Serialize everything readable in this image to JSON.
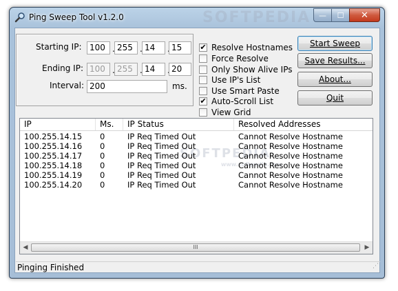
{
  "window": {
    "title": "Ping Sweep Tool v1.2.0",
    "controls": {
      "minimize": "—",
      "maximize": "☐",
      "close": "✕"
    }
  },
  "ip_range": {
    "starting_label": "Starting IP:",
    "starting_ip": [
      "100",
      "255",
      "14",
      "15"
    ],
    "ending_label": "Ending IP:",
    "ending_ip": [
      "100",
      "255",
      "14",
      "20"
    ],
    "interval_label": "Interval:",
    "interval_value": "200",
    "interval_unit": "ms.",
    "separator": "."
  },
  "options": [
    {
      "label": "Resolve Hostnames",
      "checked": true
    },
    {
      "label": "Force Resolve",
      "checked": false
    },
    {
      "label": "Only Show Alive IPs",
      "checked": false
    },
    {
      "label": "Use IP's List",
      "checked": false
    },
    {
      "label": "Use Smart Paste",
      "checked": false
    },
    {
      "label": "Auto-Scroll List",
      "checked": true
    },
    {
      "label": "View Grid",
      "checked": false
    }
  ],
  "buttons": {
    "start_sweep": "Start Sweep",
    "save_results": "Save Results...",
    "about": "About...",
    "quit": "Quit"
  },
  "results": {
    "columns": [
      "IP",
      "Ms.",
      "IP Status",
      "Resolved Addresses"
    ],
    "rows": [
      [
        "100.255.14.15",
        "0",
        "IP Req Timed Out",
        "Cannot Resolve Hostname"
      ],
      [
        "100.255.14.16",
        "0",
        "IP Req Timed Out",
        "Cannot Resolve Hostname"
      ],
      [
        "100.255.14.17",
        "0",
        "IP Req Timed Out",
        "Cannot Resolve Hostname"
      ],
      [
        "100.255.14.18",
        "0",
        "IP Req Timed Out",
        "Cannot Resolve Hostname"
      ],
      [
        "100.255.14.19",
        "0",
        "IP Req Timed Out",
        "Cannot Resolve Hostname"
      ],
      [
        "100.255.14.20",
        "0",
        "IP Req Timed Out",
        "Cannot Resolve Hostname"
      ]
    ],
    "scroll": {
      "left_arrow": "◀",
      "right_arrow": "▶",
      "thumb_grip": "III"
    }
  },
  "status_text": "Pinging Finished",
  "watermarks": {
    "title_area": "SOFTPEDIA",
    "list_area": "SOFTPEDIA",
    "list_url": "www.softpedia.com"
  },
  "colors": {
    "titlebar": "#a9c2db",
    "client_bg": "#f0f0f0",
    "close_button": "#c3391c",
    "default_button_border": "#3c7fb1"
  },
  "icons": {
    "app": "magnifier-icon",
    "checkmark": "✔"
  }
}
